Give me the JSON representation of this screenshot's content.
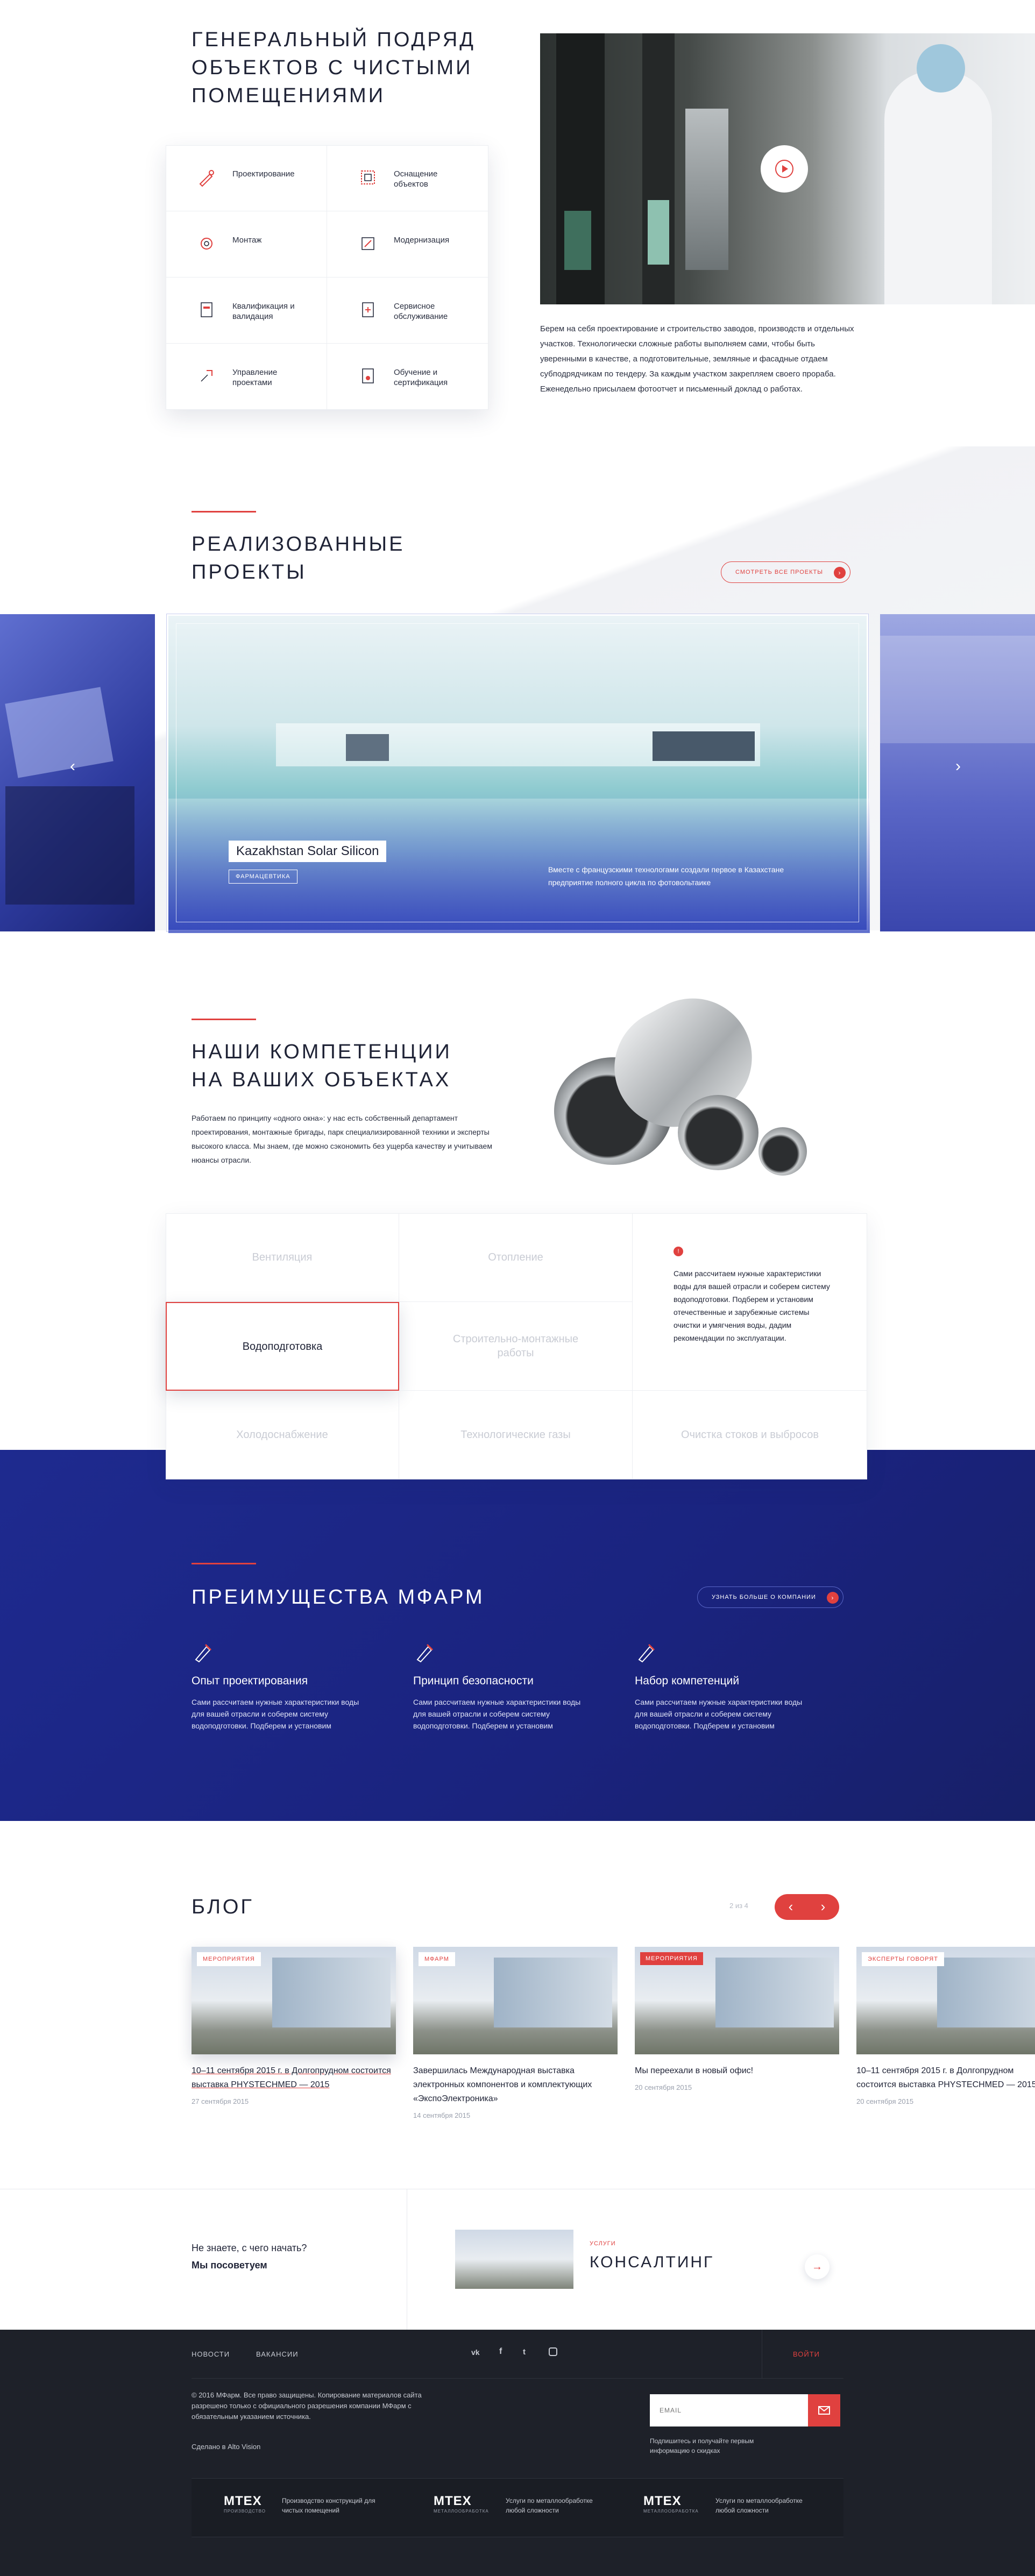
{
  "hero": {
    "title": "ГЕНЕРАЛЬНЫЙ ПОДРЯД ОБЪЕКТОВ С ЧИСТЫМИ ПОМЕЩЕНИЯМИ",
    "description": "Берем на себя проектирование и строительство заводов, производств и отдельных участков. Технологически сложные работы выполняем сами, чтобы быть уверенными в качестве, а подготовительные, земляные и фасадные отдаем субподрядчикам по тендеру. За каждым участком закрепляем своего прораба. Еженедельно присылаем фотоотчет и письменный доклад о работах.",
    "services": [
      {
        "icon": "design-icon",
        "label": "Проектирование"
      },
      {
        "icon": "equipment-icon",
        "label": "Оснащение объектов"
      },
      {
        "icon": "gear-icon",
        "label": "Монтаж"
      },
      {
        "icon": "modernization-icon",
        "label": "Модернизация"
      },
      {
        "icon": "document-icon",
        "label": "Квалификация и валидация"
      },
      {
        "icon": "service-icon",
        "label": "Сервисное обслуживание"
      },
      {
        "icon": "management-icon",
        "label": "Управление проектами"
      },
      {
        "icon": "certificate-icon",
        "label": "Обучение и сертификация"
      }
    ]
  },
  "projects": {
    "title": "РЕАЛИЗОВАННЫЕ ПРОЕКТЫ",
    "view_all": "СМОТРЕТЬ ВСЕ ПРОЕКТЫ",
    "slide_name": "Kazakhstan Solar Silicon",
    "slide_tag": "ФАРМАЦЕВТИКА",
    "slide_text": "Вместе с французскими технологами создали первое в Казахстане предприятие полного цикла по фотовольтаике",
    "prev": "‹",
    "next": "›"
  },
  "competence": {
    "title": "НАШИ КОМПЕТЕНЦИИ НА ВАШИХ ОБЪЕКТАХ",
    "text": "Работаем по принципу «одного окна»: у нас есть собственный департамент проектирования, монтажные бригады, парк специализированной техники и эксперты высокого класса. Мы знаем, где можно сэкономить без ущерба качеству и учитываем нюансы отрасли.",
    "items": [
      "Вентиляция",
      "Отопление",
      "Водоподготовка",
      "Строительно-монтажные работы",
      "Холодоснабжение",
      "Технологические газы",
      "Очистка стоков и выбросов"
    ],
    "info_mark": "!",
    "info_text": "Сами рассчитаем нужные характеристики воды для вашей отрасли и соберем систему водоподготовки. Подберем и установим отечественные и зарубежные системы очистки и умягчения воды, дадим рекомендации по эксплуатации."
  },
  "advantages": {
    "title": "ПРЕИМУЩЕСТВА МФАРМ",
    "more": "УЗНАТЬ БОЛЬШЕ О КОМПАНИИ",
    "items": [
      {
        "title": "Опыт проектирования",
        "text": "Сами рассчитаем нужные характеристики воды для вашей отрасли и соберем систему водоподготовки. Подберем и установим"
      },
      {
        "title": "Принцип безопасности",
        "text": "Сами рассчитаем нужные характеристики воды для вашей отрасли и соберем систему водоподготовки. Подберем и установим"
      },
      {
        "title": "Набор компетенций",
        "text": "Сами рассчитаем нужные характеристики воды для вашей отрасли и соберем систему водоподготовки. Подберем и установим"
      }
    ]
  },
  "blog": {
    "title": "БЛОГ",
    "pager": "2 из 4",
    "prev": "‹",
    "next": "›",
    "cards": [
      {
        "tag": "МЕРОПРИЯТИЯ",
        "title": "10–11 сентября 2015 г. в Долгопрудном состоится выставка PHYSTECHMED — 2015",
        "date": "27 сентября 2015"
      },
      {
        "tag": "МФАРМ",
        "title": "Завершилась Международная выставка электронных компонентов и комплектующих «ЭкспоЭлектроника»",
        "date": "14 сентября 2015"
      },
      {
        "tag": "МЕРОПРИЯТИЯ",
        "title": "Мы переехали в новый офис!",
        "date": "20 сентября 2015"
      },
      {
        "tag": "ЭКСПЕРТЫ ГОВОРЯТ",
        "title": "10–11 сентября 2015 г. в Долгопрудном состоится выставка PHYSTECHMED — 2015",
        "date": "20 сентября 2015"
      }
    ]
  },
  "consult": {
    "question": "Не знаете, с чего начать?",
    "answer": "Мы посоветуем",
    "label": "УСЛУГИ",
    "title": "КОНСАЛТИНГ",
    "arrow": "→"
  },
  "footer": {
    "nav": [
      "НОВОСТИ",
      "ВАКАНСИИ"
    ],
    "social": [
      "vk",
      "f",
      "t",
      "ig"
    ],
    "login": "ВОЙТИ",
    "copyright": "© 2016 МФарм. Все право защищены. Копирование материалов сайта разрешено только с официального разрешения компании МФарм с обязательным указанием источника.",
    "made_by": "Сделано в Alto Vision",
    "email_placeholder": "EMAIL",
    "subscribe_note": "Подпишитесь и получайте первым информацию о скидках",
    "brands": [
      {
        "logo": "MTEX",
        "sub": "ПРОИЗВОДСТВО",
        "text": "Производство конструкций для чистых помещений"
      },
      {
        "logo": "MTEX",
        "sub": "МЕТАЛЛООБРАБОТКА",
        "text": "Услуги по металлообработке любой сложности"
      },
      {
        "logo": "MTEX",
        "sub": "МЕТАЛЛООБРАБОТКА",
        "text": "Услуги по металлообработке любой сложности"
      }
    ]
  },
  "colors": {
    "accent": "#e0413f",
    "navy": "#1a237e",
    "dark": "#1e2129"
  }
}
